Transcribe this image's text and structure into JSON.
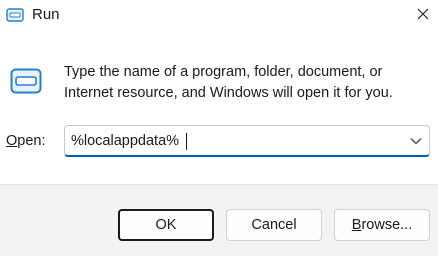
{
  "window": {
    "title": "Run",
    "icon": "run-icon",
    "close_icon": "close-icon"
  },
  "dialog": {
    "description": "Type the name of a program, folder, document, or Internet resource, and Windows will open it for you.",
    "open_label_mnemonic": "O",
    "open_label_rest": "pen:",
    "input_value": "%localappdata%",
    "dropdown_icon": "chevron-down-icon"
  },
  "buttons": {
    "ok": "OK",
    "cancel": "Cancel",
    "browse_mnemonic": "B",
    "browse_rest": "rowse..."
  },
  "colors": {
    "accent": "#005fb8",
    "footer_bg": "#f3f3f3"
  }
}
